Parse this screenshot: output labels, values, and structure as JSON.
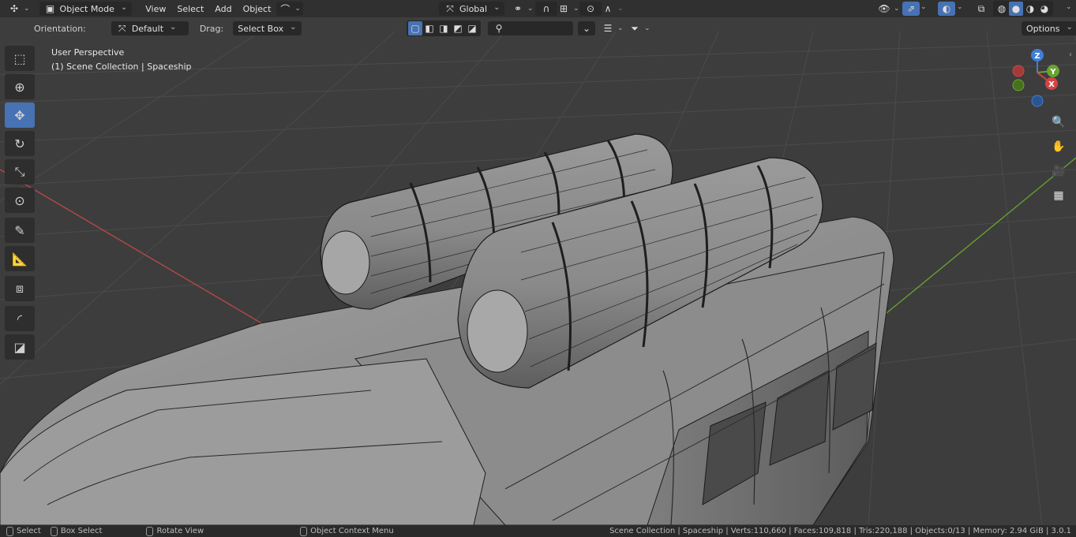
{
  "header": {
    "mode": "Object Mode",
    "menus": [
      "View",
      "Select",
      "Add",
      "Object"
    ],
    "transform_orientation": "Global",
    "shading_modes": [
      "wireframe",
      "solid",
      "material",
      "rendered"
    ],
    "active_shading": "solid"
  },
  "tool_settings": {
    "orientation_label": "Orientation:",
    "orientation_value": "Default",
    "drag_label": "Drag:",
    "drag_value": "Select Box",
    "options_label": "Options",
    "search_placeholder": ""
  },
  "viewport": {
    "perspective": "User Perspective",
    "collection_path": "(1) Scene Collection | Spaceship",
    "gizmo_axes": [
      "Z",
      "Y",
      "X"
    ]
  },
  "left_toolbar": [
    "select-box",
    "cursor",
    "move",
    "rotate",
    "scale",
    "transform",
    "annotate",
    "measure",
    "add-cube",
    "shear",
    "to-sphere"
  ],
  "status_bar": {
    "select": "Select",
    "box_select": "Box Select",
    "rotate_view": "Rotate View",
    "context_menu": "Object Context Menu",
    "stats": "Scene Collection | Spaceship | Verts:110,660 | Faces:109,818 | Tris:220,188 | Objects:0/13 | Memory: 2.94 GiB | 3.0.1"
  },
  "colors": {
    "accent": "#4772b3",
    "background": "#3d3d3d",
    "grid": "#4a4a4a",
    "x_axis": "#d24545",
    "y_axis": "#6aa32f",
    "z_axis": "#3f7fd6"
  }
}
